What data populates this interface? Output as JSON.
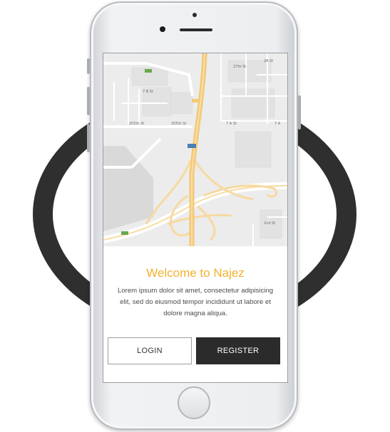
{
  "welcome": {
    "title": "Welcome to Najez",
    "description": "Lorem ipsum dolor sit amet, consectetur adipisicing elit, sed do eiusmod tempor incididunt ut labore et dolore magna aliqua."
  },
  "buttons": {
    "login": "LOGIN",
    "register": "REGISTER"
  },
  "map": {
    "street_labels": [
      "205th St",
      "205th St",
      "7 A St",
      "7 B St",
      "206th St",
      "28th St",
      "3rd St",
      "2nd St",
      "27th St",
      "2A St",
      "7 A",
      "12th St",
      "2nd St"
    ],
    "highway_shields": [
      "E311",
      "84A",
      "84C",
      "84A"
    ]
  },
  "colors": {
    "accent": "#f2b12d",
    "dark": "#2b2b2b",
    "ring": "#2f2f2f"
  },
  "icons": {
    "camera": "camera-icon",
    "speaker": "speaker-icon",
    "home": "home-button-icon"
  }
}
